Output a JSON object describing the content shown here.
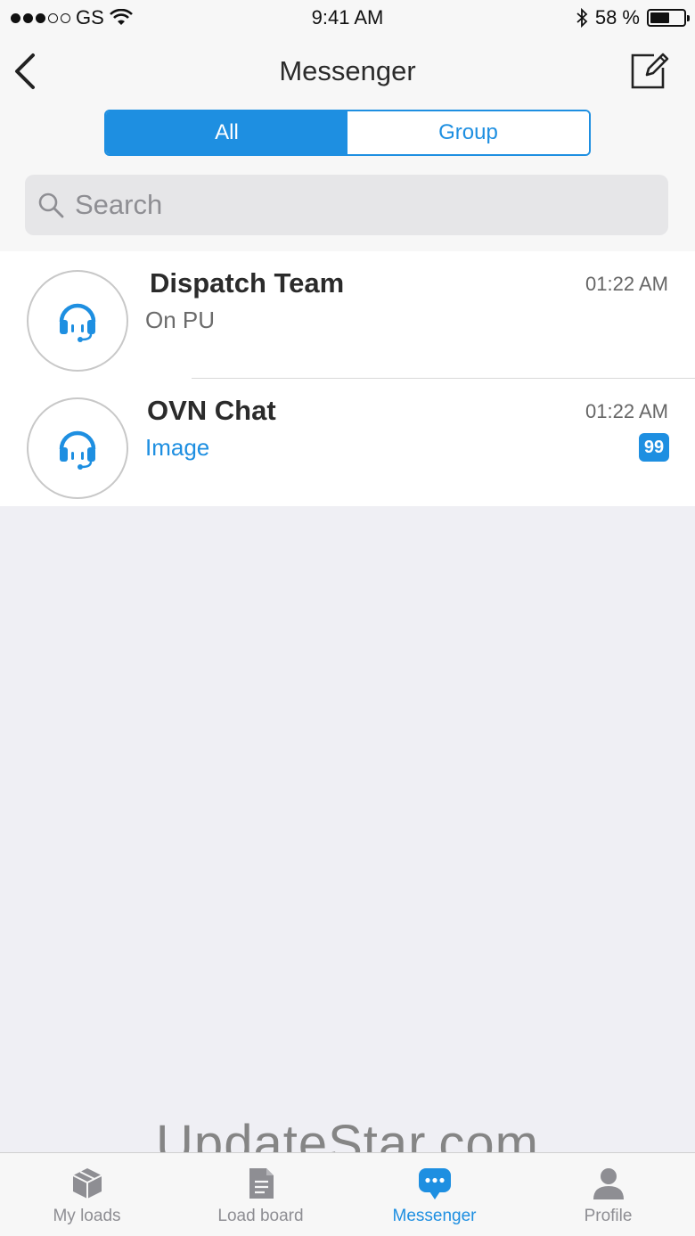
{
  "status_bar": {
    "carrier": "GS",
    "time": "9:41 AM",
    "battery": "58 %"
  },
  "nav": {
    "title": "Messenger"
  },
  "segments": {
    "all": "All",
    "group": "Group",
    "selected": "All"
  },
  "search": {
    "placeholder": "Search",
    "value": ""
  },
  "conversations": [
    {
      "title": "Dispatch Team",
      "subtitle": "On PU",
      "time": "01:22 AM",
      "badge": ""
    },
    {
      "title": "OVN Chat",
      "subtitle": "Image",
      "time": "01:22 AM",
      "badge": "99"
    }
  ],
  "watermark": "UpdateStar.com",
  "tabs": [
    {
      "label": "My loads",
      "icon": "box-icon"
    },
    {
      "label": "Load board",
      "icon": "document-icon"
    },
    {
      "label": "Messenger",
      "icon": "chat-bubble-icon",
      "active": true
    },
    {
      "label": "Profile",
      "icon": "person-icon"
    }
  ],
  "colors": {
    "accent": "#1e8fe1",
    "inactive_tab": "#8e8e93"
  }
}
